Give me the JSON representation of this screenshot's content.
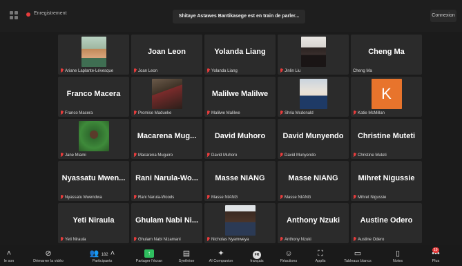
{
  "topbar": {
    "recording_label": "Enregistrement",
    "speaking_text": "Shitaye Astawes Bantikasege est en train de parler...",
    "connexion_label": "Connexion"
  },
  "participants": [
    {
      "big": "",
      "label": "Ariane Laplante-Lévesque",
      "avatar": "ariane"
    },
    {
      "big": "Joan Leon",
      "label": "Joan Leon"
    },
    {
      "big": "Yolanda Liang",
      "label": "Yolanda Liang"
    },
    {
      "big": "",
      "label": "Jinlin Liu",
      "avatar": "jinlin"
    },
    {
      "big": "Cheng Ma",
      "label": "Cheng Ma"
    },
    {
      "big": "Franco Macera",
      "label": "Franco Macera"
    },
    {
      "big": "",
      "label": "Promise Madueke",
      "avatar": "promise"
    },
    {
      "big": "Malilwe Malilwe",
      "label": "Malilwe Malilwe"
    },
    {
      "big": "",
      "label": "Shria Mcdonald",
      "avatar": "shria"
    },
    {
      "big": "",
      "label": "Katie McMillan",
      "avatar": "k",
      "avatar_letter": "K"
    },
    {
      "big": "",
      "label": "Jane Miami",
      "avatar": "jane"
    },
    {
      "big": "Macarena Mug...",
      "label": "Macarena Muguiro"
    },
    {
      "big": "David Muhoro",
      "label": "David Muhoro"
    },
    {
      "big": "David Munyendo",
      "label": "David Munyendo"
    },
    {
      "big": "Christine Muteti",
      "label": "Christine Muteti"
    },
    {
      "big": "Nyassatu Mwen...",
      "label": "Nyassatu Mwendwa"
    },
    {
      "big": "Rani Narula-Wo...",
      "label": "Rani Narula-Woods"
    },
    {
      "big": "Masse NIANG",
      "label": "Masse NIANG"
    },
    {
      "big": "Masse NIANG",
      "label": "Masse NIANG"
    },
    {
      "big": "Mihret Nigussie",
      "label": "Mihret Nigussie"
    },
    {
      "big": "Yeti Niraula",
      "label": "Yeti Niraula"
    },
    {
      "big": "Ghulam Nabi Ni...",
      "label": "Ghulam Nabi Nizamani"
    },
    {
      "big": "",
      "label": "Nicholas Nyamweya",
      "avatar": "nicholas"
    },
    {
      "big": "Anthony Nzuki",
      "label": "Anthony Nzuki"
    },
    {
      "big": "Austine Odero",
      "label": "Austine Odero"
    }
  ],
  "toolbar": {
    "audio_label": "le son",
    "video_label": "Démarrer la vidéo",
    "participants_label": "Participants",
    "participants_count": "182",
    "share_label": "Partager l'écran",
    "summary_label": "Synthèse",
    "ai_label": "AI Companion",
    "lang_label": "français",
    "lang_code": "FR",
    "reactions_label": "Réactions",
    "apps_label": "Applis",
    "whiteboard_label": "Tableaux blancs",
    "notes_label": "Notes",
    "more_label": "Plus",
    "more_badge": "19"
  }
}
